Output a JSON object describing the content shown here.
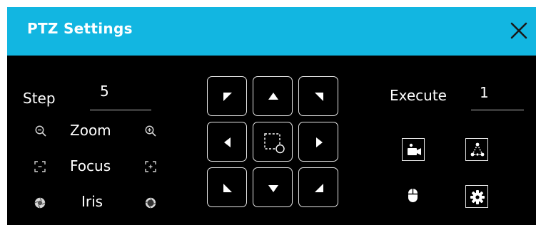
{
  "dialog": {
    "title": "PTZ Settings",
    "close_icon": "close-icon"
  },
  "step": {
    "label": "Step",
    "value": "5"
  },
  "controls": {
    "zoom_label": "Zoom",
    "focus_label": "Focus",
    "iris_label": "Iris",
    "icons": [
      "zoom-out-icon",
      "zoom-in-icon",
      "focus-near-icon",
      "focus-far-icon",
      "iris-close-icon",
      "iris-open-icon"
    ]
  },
  "direction_pad": {
    "buttons": [
      "up-left",
      "up",
      "up-right",
      "left",
      "area-zoom",
      "right",
      "down-left",
      "down",
      "down-right"
    ]
  },
  "execute": {
    "label": "Execute",
    "value": "1"
  },
  "functions": {
    "icons": [
      "preset-camera-icon",
      "cruise-path-icon",
      "mouse-icon",
      "settings-gear-icon"
    ]
  },
  "colors": {
    "title_bar": "#12b6e1",
    "background": "#000000",
    "text": "#ffffff"
  }
}
